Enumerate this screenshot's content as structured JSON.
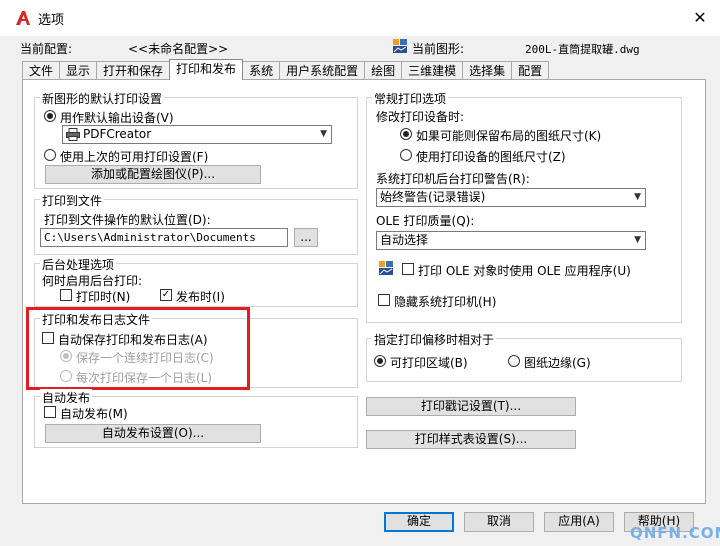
{
  "window": {
    "title": "选项",
    "close_glyph": "✕"
  },
  "header": {
    "current_profile_label": "当前配置:",
    "current_profile_value": "<<未命名配置>>",
    "current_drawing_label": "当前图形:",
    "current_drawing_value": "200L-直筒提取罐.dwg"
  },
  "tabs": [
    "文件",
    "显示",
    "打开和保存",
    "打印和发布",
    "系统",
    "用户系统配置",
    "绘图",
    "三维建模",
    "选择集",
    "配置"
  ],
  "active_tab": "打印和发布",
  "default_output": {
    "title": "新图形的默认打印设置",
    "use_device_label": "用作默认输出设备(V)",
    "device_value": "PDFCreator",
    "use_last_label": "使用上次的可用打印设置(F)",
    "add_plotter_button": "添加或配置绘图仪(P)..."
  },
  "plot_to_file": {
    "title": "打印到文件",
    "location_label": "打印到文件操作的默认位置(D):",
    "location_value": "C:\\Users\\Administrator\\Documents",
    "browse_button": "..."
  },
  "background": {
    "title": "后台处理选项",
    "enable_label": "何时启用后台打印:",
    "plotting_label": "打印时(N)",
    "publishing_label": "发布时(I)",
    "check_glyph": "✓"
  },
  "log": {
    "title": "打印和发布日志文件",
    "auto_save_label": "自动保存打印和发布日志(A)",
    "continuous_label": "保存一个连续打印日志(C)",
    "per_plot_label": "每次打印保存一个日志(L)"
  },
  "autopublish": {
    "title": "自动发布",
    "auto_label": "自动发布(M)",
    "settings_button": "自动发布设置(O)..."
  },
  "general": {
    "title": "常规打印选项",
    "modify_label": "修改打印设备时:",
    "keep_size_label": "如果可能则保留布局的图纸尺寸(K)",
    "use_device_size_label": "使用打印设备的图纸尺寸(Z)",
    "spooler_label": "系统打印机后台打印警告(R):",
    "spooler_value": "始终警告(记录错误)",
    "ole_quality_label": "OLE 打印质量(Q):",
    "ole_quality_value": "自动选择",
    "ole_app_label": "打印 OLE 对象时使用 OLE 应用程序(U)",
    "hide_printers_label": "隐藏系统打印机(H)"
  },
  "offset": {
    "title": "指定打印偏移时相对于",
    "printable_label": "可打印区域(B)",
    "edge_label": "图纸边缘(G)"
  },
  "side_buttons": {
    "stamp": "打印戳记设置(T)...",
    "styles": "打印样式表设置(S)..."
  },
  "footer": {
    "ok": "确定",
    "cancel": "取消",
    "apply": "应用(A)",
    "help": "帮助(H)"
  },
  "watermark": "QNFN.COM",
  "colors": {
    "accent": "#0078d7",
    "highlight_box": "#e02020"
  }
}
